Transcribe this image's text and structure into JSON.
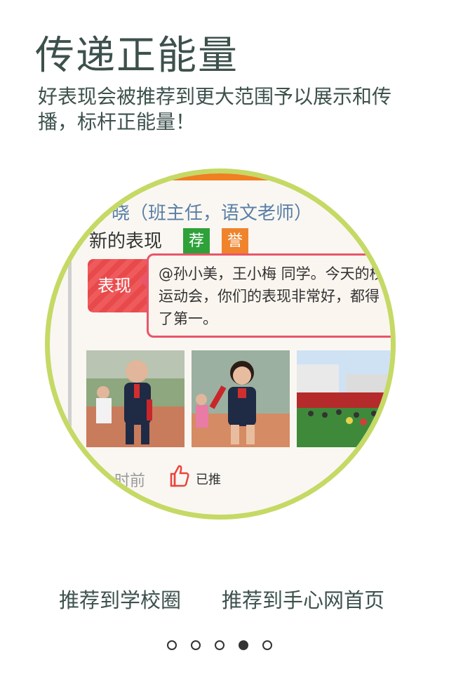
{
  "headline": "传递正能量",
  "subline": "好表现会被推荐到更大范围予以展示和传播，标杆正能量！",
  "preview": {
    "author": "晓（班主任，语文老师）",
    "title": "新的表现",
    "badges": [
      "荐",
      "誉"
    ],
    "tag": "表现",
    "message": "@孙小美，王小梅 同学。今天的校运动会，你们的表现非常好，都得了第一。",
    "time": "小时前",
    "pushed": "已推"
  },
  "links": {
    "school": "推荐到学校圈",
    "homepage": "推荐到手心网首页"
  },
  "pagination": {
    "total": 5,
    "active": 4
  },
  "colors": {
    "circle_border": "#c5d965",
    "tag_red": "#e84a4c",
    "badge_green": "#2ea13a",
    "badge_orange": "#f0842c"
  }
}
